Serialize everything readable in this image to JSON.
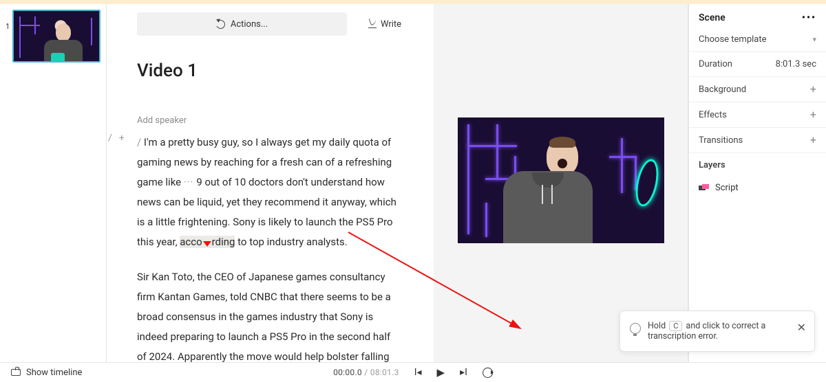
{
  "thumb": {
    "index": "1"
  },
  "toolbar": {
    "actions_label": "Actions...",
    "write_label": "Write"
  },
  "title": "Video 1",
  "add_speaker": "Add speaker",
  "gutter": {
    "slash": "/",
    "plus": "+"
  },
  "para1": {
    "slash": "/ ",
    "a": "I'm a pretty busy guy, so I always get my daily quota of gaming news by reaching for a fresh can of a refreshing game like ",
    "ell": "···",
    "b": " 9 out of 10 doctors don't understand how news can be liquid, yet they recommend it anyway, which is a little frightening. Sony is likely to launch the PS5 Pro this year, ",
    "hl_a": "acco",
    "hl_b": "rding",
    "c": " to top industry analysts."
  },
  "para2": "Sir Kan Toto, the CEO of Japanese games consultancy firm Kantan Games, told CNBC that there seems to be a broad consensus in the games industry that Sony is indeed preparing to launch a PS5 Pro in the second half of 2024. Apparently the move would help bolster falling",
  "side": {
    "header": "Scene",
    "template_label": "Choose template",
    "duration_label": "Duration",
    "duration_value": "8:01.3 sec",
    "background": "Background",
    "effects": "Effects",
    "transitions": "Transitions",
    "layers_label": "Layers",
    "layer_script": "Script"
  },
  "bottom": {
    "show_timeline": "Show timeline",
    "time_current": "00:00.0",
    "time_sep": " / ",
    "time_total": "08:01.3"
  },
  "toast": {
    "a": "Hold ",
    "key": "C",
    "b": " and click to correct a transcription error."
  }
}
